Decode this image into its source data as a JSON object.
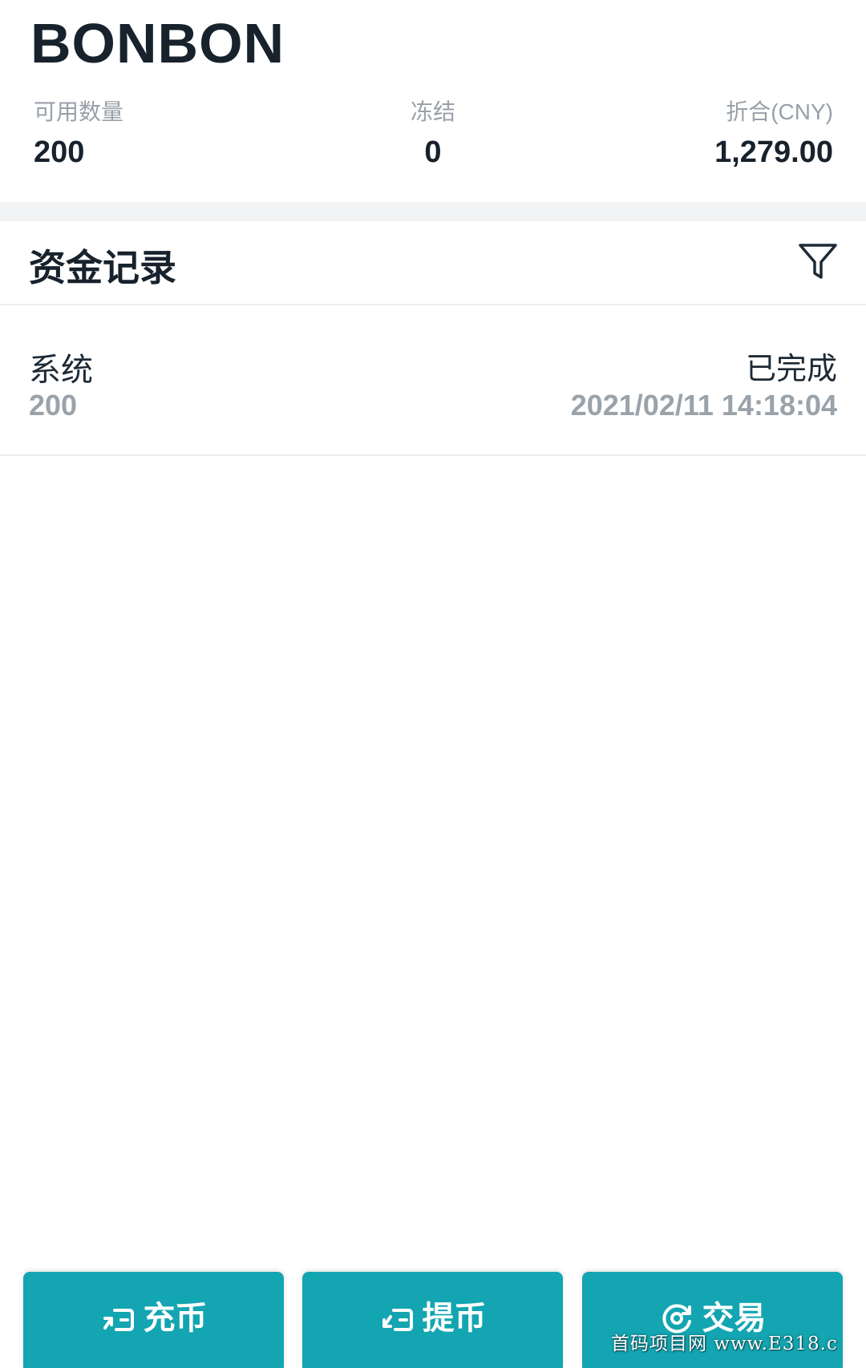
{
  "coin": {
    "name": "BONBON",
    "stats": {
      "available_label": "可用数量",
      "available_value": "200",
      "frozen_label": "冻结",
      "frozen_value": "0",
      "equivalent_label": "折合(CNY)",
      "equivalent_value": "1,279.00"
    }
  },
  "records": {
    "title": "资金记录",
    "filter_icon": "filter-icon",
    "items": [
      {
        "type": "系统",
        "amount": "200",
        "status": "已完成",
        "time": "2021/02/11 14:18:04"
      }
    ]
  },
  "actions": {
    "deposit_label": "充币",
    "withdraw_label": "提币",
    "trade_label": "交易",
    "button_color": "#13a5b1"
  },
  "watermark": "首码项目网 www.E318.c"
}
